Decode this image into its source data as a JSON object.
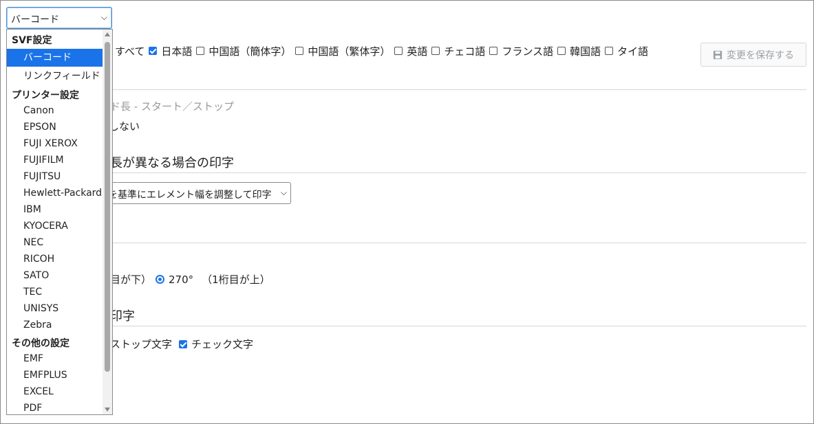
{
  "category_select": {
    "value": "バーコード",
    "chevron": "⌄"
  },
  "languages": {
    "all_label": "すべて",
    "items": [
      {
        "label": "日本語",
        "checked": true
      },
      {
        "label": "中国語（簡体字）",
        "checked": false
      },
      {
        "label": "中国語（繁体字）",
        "checked": false
      },
      {
        "label": "英語",
        "checked": false
      },
      {
        "label": "チェコ語",
        "checked": false
      },
      {
        "label": "フランス語",
        "checked": false
      },
      {
        "label": "韓国語",
        "checked": false
      },
      {
        "label": "タイ語",
        "checked": false
      }
    ]
  },
  "save_button": {
    "label": "変更を保存する",
    "icon": "save-icon"
  },
  "section1": {
    "subtitle": "ド長 - スタート／ストップ",
    "value": "しない"
  },
  "section2": {
    "title": "長が異なる場合の印字",
    "select_value": "を基準にエレメント幅を調整して印字"
  },
  "section3": {
    "rotation_prefix": "目が下）",
    "rotation_value": "270°",
    "rotation_note": "（1桁目が上）"
  },
  "section4": {
    "title": "印字",
    "stop_label": "ストップ文字",
    "check_label": "チェック文字"
  },
  "dropdown": {
    "groups": [
      {
        "label": "SVF設定",
        "options": [
          "バーコード",
          "リンクフィールド"
        ],
        "selected": "バーコード"
      },
      {
        "label": "プリンター設定",
        "options": [
          "Canon",
          "EPSON",
          "FUJI XEROX",
          "FUJIFILM",
          "FUJITSU",
          "Hewlett-Packard",
          "IBM",
          "KYOCERA",
          "NEC",
          "RICOH",
          "SATO",
          "TEC",
          "UNISYS",
          "Zebra"
        ]
      },
      {
        "label": "その他の設定",
        "options": [
          "EMF",
          "EMFPLUS",
          "EXCEL",
          "PDF"
        ]
      }
    ]
  },
  "colors": {
    "accent": "#1a73e8",
    "disabled_text": "#9aa0a6",
    "rule": "#d6d6d6"
  }
}
